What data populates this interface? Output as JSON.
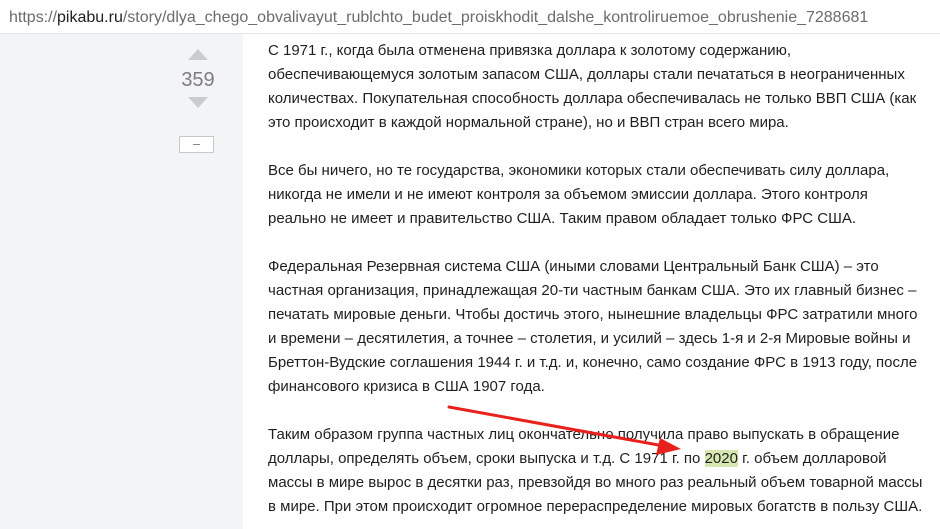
{
  "browser": {
    "url_scheme": "https://",
    "url_host": "pikabu.ru",
    "url_path": "/story/dlya_chego_obvalivayut_rublchto_budet_proiskhodit_dalshe_kontroliruemoe_obrushenie_7288681"
  },
  "post": {
    "rating": "359",
    "paragraphs": [
      "С 1971 г., когда была отменена привязка доллара к золотому содержанию, обеспечивающемуся золотым запасом США, доллары стали печататься в неограниченных количествах. Покупательная способность доллара обеспечивалась не только ВВП США (как это происходит в каждой нормальной стране), но и ВВП стран всего мира.",
      "Все бы ничего, но те государства, экономики которых стали обеспечивать силу доллара, никогда не имели и не имеют контроля за объемом эмиссии доллара. Этого контроля реально не имеет и правительство США. Таким правом обладает только ФРС США.",
      "Федеральная Резервная система США (иными словами Центральный Банк США) – это частная организация, принадлежащая 20-ти частным банкам США. Это их главный бизнес – печатать мировые деньги. Чтобы достичь этого, нынешние владельцы ФРС затратили много и времени – десятилетия, а точнее – столетия, и усилий – здесь 1-я и 2-я Мировые войны и Бреттон-Вудские соглашения 1944 г. и т.д. и, конечно, само создание ФРС в 1913 году, после финансового кризиса в США 1907 года."
    ],
    "last_paragraph": {
      "before": "Таким образом группа частных лиц окончательно получила право выпускать в обращение доллары, определять объем, сроки выпуска и т.д. С 1971 г. по ",
      "highlight": "2020",
      "after": " г. объем долларовой массы в мире вырос в десятки раз, превзойдя во много раз реальный объем товарной массы в мире. При этом происходит огромное перераспределение мировых богатств в пользу США."
    }
  },
  "colors": {
    "gutter": "#f3f4f5",
    "highlight": "#d6e8b0",
    "arrow": "#e8211d",
    "vote_arrow": "#c9cbcd"
  },
  "icons": {
    "upvote": "triangle-up",
    "downvote": "triangle-down",
    "collapse": "minus"
  }
}
